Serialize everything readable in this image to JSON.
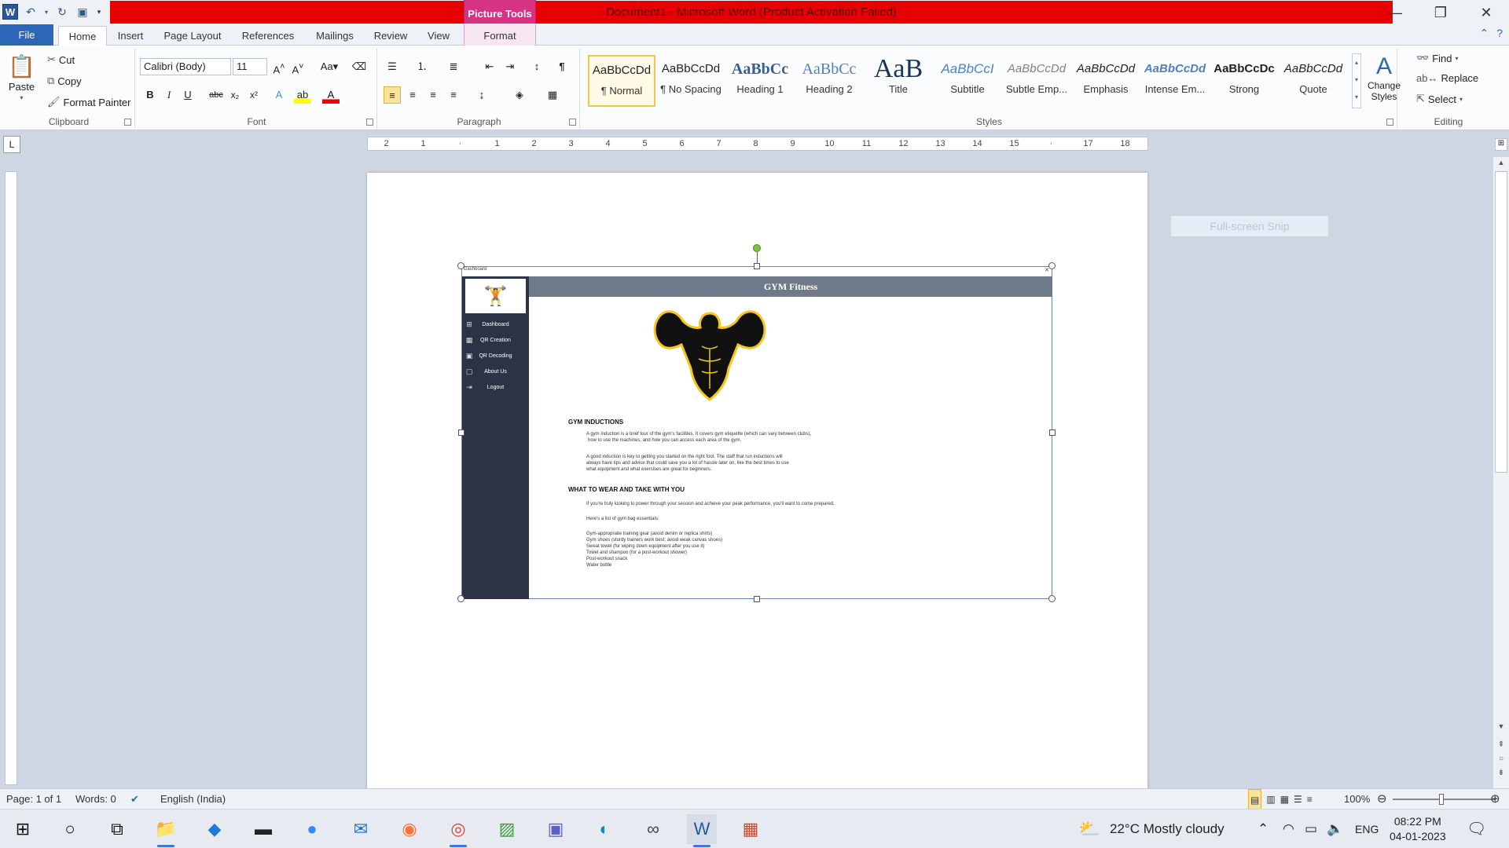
{
  "window": {
    "title": "Document1  -  Microsoft Word (Product Activation Failed)",
    "context_tab_group": "Picture Tools"
  },
  "tabs": [
    "File",
    "Home",
    "Insert",
    "Page Layout",
    "References",
    "Mailings",
    "Review",
    "View",
    "Format"
  ],
  "clipboard": {
    "paste": "Paste",
    "cut": "Cut",
    "copy": "Copy",
    "format_painter": "Format Painter",
    "group": "Clipboard"
  },
  "font": {
    "name": "Calibri (Body)",
    "size": "11",
    "group": "Font"
  },
  "paragraph": {
    "group": "Paragraph"
  },
  "styles": {
    "group": "Styles",
    "items": [
      {
        "preview": "AaBbCcDd",
        "label": "¶ Normal"
      },
      {
        "preview": "AaBbCcDd",
        "label": "¶ No Spacing"
      },
      {
        "preview": "AaBbCc",
        "label": "Heading 1"
      },
      {
        "preview": "AaBbCc",
        "label": "Heading 2"
      },
      {
        "preview": "AaB",
        "label": "Title"
      },
      {
        "preview": "AaBbCcI",
        "label": "Subtitle"
      },
      {
        "preview": "AaBbCcDd",
        "label": "Subtle Emp..."
      },
      {
        "preview": "AaBbCcDd",
        "label": "Emphasis"
      },
      {
        "preview": "AaBbCcDd",
        "label": "Intense Em..."
      },
      {
        "preview": "AaBbCcDc",
        "label": "Strong"
      },
      {
        "preview": "AaBbCcDd",
        "label": "Quote"
      }
    ],
    "change_styles": "Change Styles"
  },
  "editing": {
    "find": "Find",
    "replace": "Replace",
    "select": "Select",
    "group": "Editing"
  },
  "ruler": {
    "marks": [
      "2",
      "1",
      "",
      "1",
      "2",
      "3",
      "4",
      "5",
      "6",
      "7",
      "8",
      "9",
      "10",
      "11",
      "12",
      "13",
      "14",
      "15",
      "",
      "17",
      "18"
    ]
  },
  "document_image": {
    "top_label": "Dashboard",
    "header": "GYM Fitness",
    "sidebar": [
      "Dashboard",
      "QR Creation",
      "QR Decoding",
      "About Us",
      "Logout"
    ],
    "heading1": "GYM INDUCTIONS",
    "para1": [
      "A gym induction is a brief tour of the gym's facilities. It covers gym etiquette (which can vary between clubs),",
      "how to use the machines, and how you can access each area of the gym."
    ],
    "para2": [
      "A good induction is key to getting you started on the right foot. The staff that run inductions will",
      "always have tips and advice that could save you a lot of hassle later on, like the best times to use",
      "what equipment and what exercises are great for beginners."
    ],
    "heading2": "WHAT TO WEAR AND TAKE WITH YOU",
    "para3": "If you're truly looking to power through your session and achieve your peak performance, you'll want to come prepared.",
    "para4": "Here's a list of gym bag essentials:",
    "list": [
      "Gym-appropriate training gear (avoid denim or replica shirts)",
      "Gym shoes (sturdy trainers work best; avoid weak canvas shoes)",
      "Sweat towel (for wiping down equipment after you use it)",
      "Towel and shampoo (for a post-workout shower)",
      "Post-workout snack",
      "Water bottle"
    ]
  },
  "snip_overlay": "Full-screen Snip",
  "status": {
    "page": "Page: 1 of 1",
    "words": "Words: 0",
    "language": "English (India)",
    "zoom": "100%"
  },
  "taskbar": {
    "weather": "22°C  Mostly cloudy",
    "lang": "ENG",
    "time": "08:22 PM",
    "date": "04-01-2023"
  },
  "colors": {
    "title_red": "#e60000",
    "picture_tools": "#d63384",
    "file_blue": "#2b66b7",
    "sidebar": "#2c3346",
    "header": "#6e7a89"
  }
}
